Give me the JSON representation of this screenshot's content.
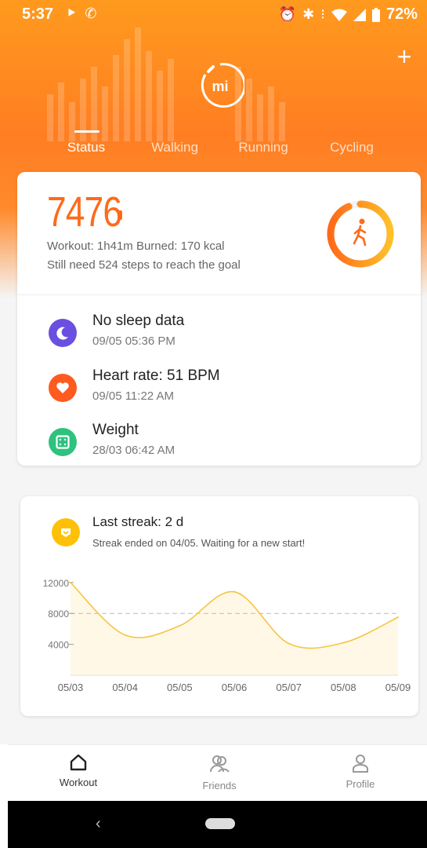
{
  "status_bar": {
    "time": "5:37",
    "battery": "72%",
    "left_icons": [
      "cast-icon",
      "phone-icon"
    ],
    "right_icons": [
      "alarm-icon",
      "bluetooth-icon",
      "vibrate-icon",
      "wifi-icon",
      "signal-icon",
      "battery-icon"
    ]
  },
  "header": {
    "logo_text": "mi",
    "add_icon": "plus-icon"
  },
  "tabs": [
    {
      "label": "Status",
      "active": true
    },
    {
      "label": "Walking",
      "active": false
    },
    {
      "label": "Running",
      "active": false
    },
    {
      "label": "Cycling",
      "active": false
    }
  ],
  "summary": {
    "steps": "7476",
    "workout_text": "Workout: 1h41m Burned: 170 kcal",
    "goal_text": "Still need 524 steps to reach the goal",
    "goal_progress": 0.9345,
    "ring_icon": "walking-icon"
  },
  "metrics": [
    {
      "title": "No sleep data",
      "subtitle": "09/05 05:36 PM",
      "icon": "sleep-icon",
      "color": "#6a4fe0"
    },
    {
      "title": "Heart rate: 51 BPM",
      "subtitle": "09/05 11:22 AM",
      "icon": "heart-icon",
      "color": "#ff5a1f"
    },
    {
      "title": "Weight",
      "subtitle": "28/03 06:42 AM",
      "icon": "scale-icon",
      "color": "#2ec27e"
    }
  ],
  "streak": {
    "title": "Last streak: 2 d",
    "subtitle": "Streak ended on 04/05. Waiting for a new start!",
    "icon": "streak-badge-icon"
  },
  "chart_data": {
    "type": "line",
    "categories": [
      "05/03",
      "05/04",
      "05/05",
      "05/06",
      "05/07",
      "05/08",
      "05/09"
    ],
    "y_ticks": [
      "12000",
      "8000",
      "4000"
    ],
    "y_tick_values": [
      12000,
      8000,
      4000
    ],
    "goal_line": 8000,
    "values": [
      12000,
      5200,
      6400,
      10800,
      4100,
      4200,
      7500
    ],
    "ylim": [
      0,
      13000
    ],
    "grid": false,
    "line_color": "#f5c542"
  },
  "bottom_nav": [
    {
      "label": "Workout",
      "icon": "home-icon",
      "active": true
    },
    {
      "label": "Friends",
      "icon": "friends-icon",
      "active": false
    },
    {
      "label": "Profile",
      "icon": "profile-icon",
      "active": false
    }
  ],
  "system_nav": {
    "back": "‹"
  }
}
